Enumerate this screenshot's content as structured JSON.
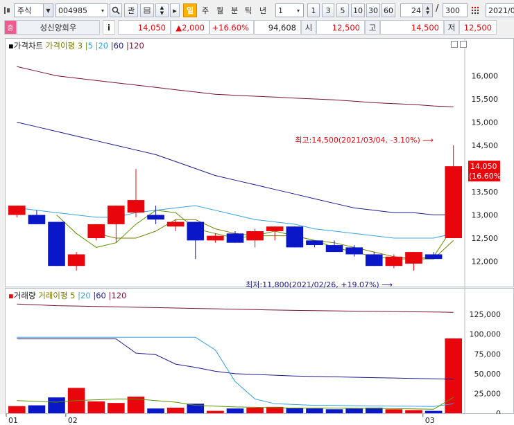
{
  "toolbar": {
    "market_select": "주식",
    "code": "004985",
    "btn_related": "관",
    "periods": [
      "일",
      "주",
      "월",
      "분",
      "틱",
      "년"
    ],
    "active_period": "일",
    "interval_select": "1",
    "interval_buttons": [
      "1",
      "3",
      "5",
      "10",
      "30",
      "60"
    ],
    "zoom_value": "24",
    "total_count": "300",
    "date": "2021/0"
  },
  "quote": {
    "badge": "증",
    "name": "성신양회우",
    "info": "i",
    "price": "14,050",
    "change": "▲2,000",
    "change_pct": "+16.60%",
    "volume": "94,608",
    "open_label": "시",
    "open": "12,500",
    "high_label": "고",
    "high": "14,500",
    "low_label": "저",
    "low": "12,500"
  },
  "price_legend": {
    "title": "가격차트",
    "ma_label": "가격이평 3",
    "ma_periods": [
      "5",
      "20",
      "60",
      "120"
    ]
  },
  "volume_legend": {
    "title": "거래량",
    "ma_label": "거래이평 5",
    "ma_periods": [
      "20",
      "60",
      "120"
    ]
  },
  "colors": {
    "up": "#e8060c",
    "down": "#0a17c8",
    "ma3": "#5a9400",
    "ma5": "#7b7b00",
    "ma20": "#36a0e0",
    "ma60": "#1a1a8a",
    "ma120": "#7a1030"
  },
  "chart_data": {
    "type": "candlestick",
    "price_axis": {
      "ticks": [
        "16,000",
        "15,500",
        "15,000",
        "14,500",
        "14,000",
        "13,500",
        "13,000",
        "12,500",
        "12,000"
      ],
      "ylim": [
        11500,
        16500
      ]
    },
    "candles": [
      {
        "o": 13000,
        "h": 13200,
        "l": 12950,
        "c": 13200
      },
      {
        "o": 13000,
        "h": 13100,
        "l": 12800,
        "c": 12800
      },
      {
        "o": 12850,
        "h": 12850,
        "l": 11900,
        "c": 11900
      },
      {
        "o": 11900,
        "h": 12200,
        "l": 11800,
        "c": 12150
      },
      {
        "o": 12500,
        "h": 12800,
        "l": 12450,
        "c": 12800
      },
      {
        "o": 12800,
        "h": 13200,
        "l": 12400,
        "c": 13200
      },
      {
        "o": 13050,
        "h": 13990,
        "l": 12950,
        "c": 13320
      },
      {
        "o": 13000,
        "h": 13200,
        "l": 12800,
        "c": 12900
      },
      {
        "o": 12750,
        "h": 12900,
        "l": 12650,
        "c": 12850
      },
      {
        "o": 12850,
        "h": 12850,
        "l": 12050,
        "c": 12450
      },
      {
        "o": 12450,
        "h": 12600,
        "l": 12400,
        "c": 12550
      },
      {
        "o": 12600,
        "h": 12650,
        "l": 12400,
        "c": 12400
      },
      {
        "o": 12450,
        "h": 12700,
        "l": 12300,
        "c": 12650
      },
      {
        "o": 12650,
        "h": 12750,
        "l": 12450,
        "c": 12750
      },
      {
        "o": 12750,
        "h": 12750,
        "l": 12300,
        "c": 12300
      },
      {
        "o": 12450,
        "h": 12450,
        "l": 12300,
        "c": 12350
      },
      {
        "o": 12350,
        "h": 12450,
        "l": 12200,
        "c": 12200
      },
      {
        "o": 12300,
        "h": 12350,
        "l": 12100,
        "c": 12150
      },
      {
        "o": 12150,
        "h": 12200,
        "l": 11900,
        "c": 11900
      },
      {
        "o": 11900,
        "h": 12150,
        "l": 11850,
        "c": 12100
      },
      {
        "o": 11950,
        "h": 12200,
        "l": 11800,
        "c": 12200
      },
      {
        "o": 12150,
        "h": 12200,
        "l": 12050,
        "c": 12050
      },
      {
        "o": 12500,
        "h": 14500,
        "l": 12500,
        "c": 14050
      }
    ],
    "x_label_idx": {
      "01": 0,
      "02": 3,
      "03": 21
    },
    "ma3": [
      null,
      null,
      13000,
      12600,
      12300,
      12400,
      12800,
      13100,
      13050,
      12700,
      12600,
      12500,
      12550,
      12650,
      12550,
      12450,
      12300,
      12200,
      12100,
      12050,
      12050,
      12100,
      12750
    ],
    "ma5": [
      null,
      null,
      null,
      null,
      12600,
      12500,
      12500,
      12650,
      12900,
      12900,
      12700,
      12600,
      12550,
      12550,
      12550,
      12450,
      12400,
      12300,
      12200,
      12100,
      12050,
      12050,
      12450
    ],
    "ma20": [
      13150,
      13100,
      13050,
      13000,
      12950,
      12950,
      13050,
      13100,
      13150,
      13200,
      13100,
      13000,
      12900,
      12850,
      12800,
      12700,
      12650,
      12600,
      12550,
      12500,
      12500,
      12500,
      12600
    ],
    "ma60": [
      15000,
      14900,
      14800,
      14700,
      14600,
      14500,
      14400,
      14300,
      14150,
      14000,
      13850,
      13750,
      13650,
      13550,
      13450,
      13350,
      13250,
      13150,
      13100,
      13050,
      13050,
      13000,
      13000
    ],
    "ma120": [
      16200,
      16100,
      16000,
      15950,
      15900,
      15850,
      15800,
      15750,
      15700,
      15650,
      15600,
      15580,
      15560,
      15540,
      15520,
      15500,
      15480,
      15450,
      15420,
      15400,
      15380,
      15350,
      15330
    ],
    "max_annotation": "최고:14,500(2021/03/04, -3.10%)",
    "min_annotation": "최저:11,800(2021/02/26, +19.07%)",
    "last_price_label": "14,050",
    "last_pct_label": "(16.60%)",
    "volume_axis": {
      "ticks": [
        "125,000",
        "100,000",
        "75,000",
        "50,000",
        "25,000",
        "0"
      ],
      "ylim": [
        0,
        140000
      ]
    },
    "volume": [
      9000,
      10000,
      20000,
      32000,
      15000,
      13000,
      21000,
      6000,
      7000,
      12000,
      3000,
      6000,
      7000,
      8000,
      7000,
      6000,
      5000,
      6000,
      7000,
      5000,
      4000,
      3000,
      94608
    ],
    "vol_ma5": [
      16000,
      15000,
      14000,
      16000,
      17000,
      18000,
      18000,
      16000,
      14000,
      10000,
      9000,
      8000,
      7500,
      7000,
      6500,
      6500,
      6500,
      6200,
      6000,
      5800,
      5500,
      5000,
      20000
    ],
    "vol_ma20": [
      96000,
      96000,
      96000,
      96000,
      96000,
      96000,
      96000,
      96000,
      96000,
      96000,
      80000,
      40000,
      18000,
      12000,
      11000,
      10000,
      10000,
      9500,
      9200,
      9000,
      8800,
      8500,
      12000
    ],
    "vol_ma60": [
      94000,
      94000,
      94000,
      94000,
      94000,
      94000,
      76000,
      74000,
      62000,
      58000,
      53000,
      50000,
      49000,
      48000,
      47000,
      46500,
      46000,
      45500,
      45000,
      44500,
      44000,
      43500,
      43000
    ],
    "vol_ma120": [
      138000,
      137000,
      136000,
      135500,
      135000,
      134500,
      134000,
      133500,
      133000,
      132500,
      132000,
      131500,
      131000,
      130500,
      130000,
      129700,
      129400,
      129100,
      128800,
      128500,
      128200,
      128000,
      127500
    ],
    "x_labels": [
      "01",
      "02",
      "03"
    ]
  }
}
